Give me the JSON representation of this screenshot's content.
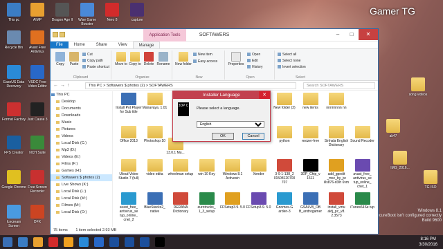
{
  "desktop": {
    "corner_text": "Gamer TG",
    "activation": [
      "Windows 8.1",
      "SecureBoot isn't configured correctly",
      "Build 9600"
    ],
    "icons": [
      {
        "label": "This pc",
        "color": "#3b7dc4"
      },
      {
        "label": "AIMP",
        "color": "#e8a030"
      },
      {
        "label": "Dragon Age II",
        "color": "#555555"
      },
      {
        "label": "Wise Game Booster",
        "color": "#4a89d8"
      },
      {
        "label": "Nero 8",
        "color": "#d22b2b"
      },
      {
        "label": "capture",
        "color": "#4a3070"
      },
      {
        "label": "Recycle Bin",
        "color": "#6a8ab0"
      },
      {
        "label": "Avast Free Antivirus",
        "color": "#e07020"
      },
      {
        "label": "EaseUS Data Recovery",
        "color": "#2a8ad8"
      },
      {
        "label": "VSDC Free Video Editor",
        "color": "#2868c8"
      },
      {
        "label": "Format Factory",
        "color": "#cc3030"
      },
      {
        "label": "Just Cause 3",
        "color": "#222222"
      },
      {
        "label": "FPS Creator",
        "color": "#1a5fa0"
      },
      {
        "label": "NCH Suite",
        "color": "#3a8a3a"
      },
      {
        "label": "Google Chrome",
        "color": "#e0c020"
      },
      {
        "label": "Free Screen Recorder",
        "color": "#c83030"
      },
      {
        "label": "Icecream Screen",
        "color": "#4a9ae0"
      },
      {
        "label": "DFX",
        "color": "#cc4422"
      }
    ],
    "right_icons": [
      {
        "label": "song videos"
      },
      {
        "label": "ak47"
      },
      {
        "label": "IMG_2016..."
      },
      {
        "label": "TG ISO"
      }
    ]
  },
  "explorer": {
    "window_title": "SOFTAWERS",
    "context_tab": "Application Tools",
    "tabs": [
      "File",
      "Home",
      "Share",
      "View",
      "Manage"
    ],
    "ribbon": {
      "clipboard": {
        "name": "Clipboard",
        "copy": "Copy",
        "paste": "Paste",
        "cut": "Cut",
        "copy_path": "Copy path",
        "paste_shortcut": "Paste shortcut"
      },
      "organize": {
        "name": "Organize",
        "move_to": "Move to",
        "copy_to": "Copy to",
        "delete": "Delete",
        "rename": "Rename"
      },
      "new": {
        "name": "New",
        "new_folder": "New folder",
        "new_item": "New item",
        "easy_access": "Easy access"
      },
      "open": {
        "name": "Open",
        "properties": "Properties",
        "open": "Open",
        "edit": "Edit",
        "history": "History"
      },
      "select": {
        "name": "Select",
        "select_all": "Select all",
        "select_none": "Select none",
        "invert": "Invert selection"
      }
    },
    "address": {
      "path": "This PC  >  Softawers $ photos (2)  >  SOFTAWERS",
      "search_placeholder": "Search SOFTAWERS"
    },
    "nav_items": [
      {
        "label": "This PC",
        "root": true
      },
      {
        "label": "Desktop"
      },
      {
        "label": "Documents"
      },
      {
        "label": "Downloads"
      },
      {
        "label": "Music"
      },
      {
        "label": "Pictures"
      },
      {
        "label": "Videos"
      },
      {
        "label": "Local Disk (C:)"
      },
      {
        "label": "Mp3 (D:)"
      },
      {
        "label": "Videos (E:)"
      },
      {
        "label": "Films (F:)"
      },
      {
        "label": "Games (H:)"
      },
      {
        "label": "Softawers $ photos (2)",
        "selected": true
      },
      {
        "label": "Live Shows (K:)"
      },
      {
        "label": "Local Disk (L:)"
      },
      {
        "label": "Local Disk (M:)"
      },
      {
        "label": "Filmes (M:)"
      },
      {
        "label": "Local Disk (O:)"
      }
    ],
    "files": [
      {
        "label": "Install Pot Player for Sub title",
        "kind": "app"
      },
      {
        "label": "Manavaya. 1.01",
        "kind": "folder"
      },
      {
        "label": "Mi...",
        "kind": "folder"
      },
      {
        "label": "New folder (2)",
        "kind": "folder"
      },
      {
        "label": "new items",
        "kind": "folder"
      },
      {
        "label": "nnnnnnnn nn",
        "kind": "folder"
      },
      {
        "label": "Office 2013",
        "kind": "folder"
      },
      {
        "label": "Photoshop 10",
        "kind": "folder"
      },
      {
        "label": "python",
        "kind": "folder"
      },
      {
        "label": "resizer-free",
        "kind": "folder"
      },
      {
        "label": "Sinhala English Dictionary",
        "kind": "folder"
      },
      {
        "label": "Sound Recoder",
        "kind": "folder"
      },
      {
        "label": "13.0.1 Mu...",
        "kind": "folder"
      },
      {
        "label": "Ulead Video Studio 7 (full)",
        "kind": "folder"
      },
      {
        "label": "video edita",
        "kind": "folder"
      },
      {
        "label": "wheelman setup",
        "kind": "folder"
      },
      {
        "label": "win 10 Key",
        "kind": "folder"
      },
      {
        "label": "Windows 8.1 Activesin",
        "kind": "folder"
      },
      {
        "label": "Xender",
        "kind": "folder"
      },
      {
        "label": "3-9-1-138_2 01508120700 707",
        "kind": "file"
      },
      {
        "label": "3DP_Chip_v 1611",
        "kind": "app"
      },
      {
        "label": "add_gpedit _msc_by_jw ills876-d3lh 6vm",
        "kind": "app"
      },
      {
        "label": "avast_free_ antivirus_se tup_online_ cnet_1",
        "kind": "app"
      },
      {
        "label": "avast_free_ antivirus_se tup_online_ cnet_2",
        "kind": "app"
      },
      {
        "label": "BlueStacks2_ native",
        "kind": "app"
      },
      {
        "label": "DERANA Dictionary",
        "kind": "app"
      },
      {
        "label": "eurotrucks_ 1_3_setup",
        "kind": "app"
      },
      {
        "label": "FFSetup3.9. 5.0",
        "kind": "app"
      },
      {
        "label": "FFSetup3.9. 5.0",
        "kind": "app"
      },
      {
        "label": "Gnomes-G arden-3",
        "kind": "app"
      },
      {
        "label": "GSALV8_OB B_androgamer",
        "kind": "app"
      },
      {
        "label": "install_virtu aldj_pc_v8. 2.3573",
        "kind": "app"
      },
      {
        "label": "iTunes64Se tup",
        "kind": "app"
      }
    ],
    "status": {
      "count": "75 items",
      "selected": "1 item selected  2.93 MB"
    }
  },
  "dialog": {
    "title": "Installer Language",
    "logo_text": "3DP C",
    "message": "Please select a language.",
    "selected_language": "English",
    "ok": "OK",
    "cancel": "Cancel"
  },
  "taskbar": {
    "time": "8:16 PM",
    "date": "3/30/2016",
    "items": [
      "#3b7dc4",
      "#e8a030",
      "#d22b2b",
      "#f0a020",
      "#2a8ad8",
      "#2868c8",
      "#1c4f9c",
      "#1c4f9c",
      "#1c4f9c",
      "#000000"
    ]
  },
  "colors": {
    "accent": "#1979ca",
    "dialog_title": "#c2414f",
    "context_tab": "#f5c8d9"
  }
}
